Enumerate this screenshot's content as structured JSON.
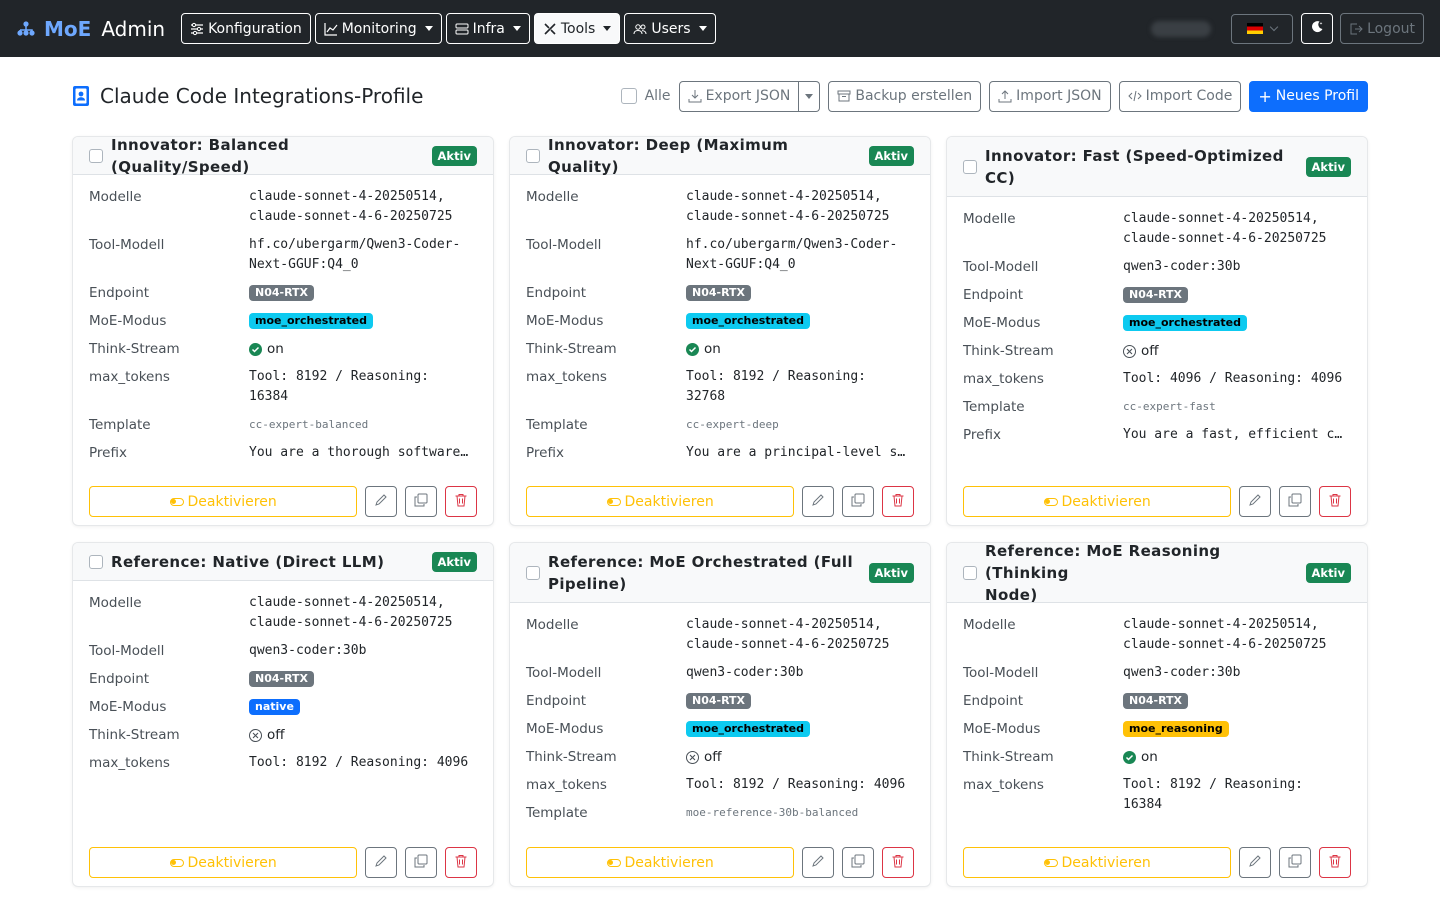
{
  "nav": {
    "brand_moe": "MoE",
    "brand_admin": "Admin",
    "menu": [
      {
        "label": "Konfiguration",
        "icon": "sliders-icon"
      },
      {
        "label": "Monitoring",
        "icon": "chart-line-icon"
      },
      {
        "label": "Infra",
        "icon": "server-icon"
      },
      {
        "label": "Tools",
        "icon": "tools-icon"
      },
      {
        "label": "Users",
        "icon": "users-icon"
      }
    ],
    "logout": "Logout",
    "language_flag": "de-flag-icon"
  },
  "header": {
    "title": "Claude Code Integrations-Profile",
    "select_all": "Alle",
    "export_json": "Export JSON",
    "backup": "Backup erstellen",
    "import_json": "Import JSON",
    "import_code": "Import Code",
    "new_profile": "Neues Profil"
  },
  "labels": {
    "models": "Modelle",
    "tool_model": "Tool-Modell",
    "endpoint": "Endpoint",
    "moe_mode": "MoE-Modus",
    "think_stream": "Think-Stream",
    "max_tokens": "max_tokens",
    "template": "Template",
    "prefix": "Prefix",
    "deactivate": "Deaktivieren",
    "active": "Aktiv"
  },
  "colors": {
    "navbar": "#212529",
    "primary": "#0d6efd",
    "success": "#198754",
    "warning": "#ffc107",
    "danger": "#dc3545",
    "info": "#0dcaf0"
  },
  "profiles": [
    {
      "title": "Innovator: Balanced (Quality/Speed)",
      "models_1": "claude-sonnet-4-20250514,",
      "models_2": "claude-sonnet-4-6-20250725",
      "tool_model_1": "hf.co/ubergarm/Qwen3-Coder-",
      "tool_model_2": "Next-GGUF:Q4_0",
      "endpoint": "N04-RTX",
      "moe_mode": "moe_orchestrated",
      "think_stream": "on",
      "max_tokens_1": "Tool: 8192 / Reasoning:",
      "max_tokens_2": "16384",
      "template": "cc-expert-balanced",
      "prefix": "You are a thorough software…"
    },
    {
      "title": "Innovator: Deep (Maximum Quality)",
      "models_1": "claude-sonnet-4-20250514,",
      "models_2": "claude-sonnet-4-6-20250725",
      "tool_model_1": "hf.co/ubergarm/Qwen3-Coder-",
      "tool_model_2": "Next-GGUF:Q4_0",
      "endpoint": "N04-RTX",
      "moe_mode": "moe_orchestrated",
      "think_stream": "on",
      "max_tokens_1": "Tool: 8192 / Reasoning:",
      "max_tokens_2": "32768",
      "template": "cc-expert-deep",
      "prefix": "You are a principal-level s…"
    },
    {
      "title_1": "Innovator: Fast (Speed-Optimized",
      "title_2": "CC)",
      "models_1": "claude-sonnet-4-20250514,",
      "models_2": "claude-sonnet-4-6-20250725",
      "tool_model": "qwen3-coder:30b",
      "endpoint": "N04-RTX",
      "moe_mode": "moe_orchestrated",
      "think_stream": "off",
      "max_tokens": "Tool: 4096 / Reasoning: 4096",
      "template": "cc-expert-fast",
      "prefix": "You are a fast, efficient c…"
    },
    {
      "title": "Reference: Native (Direct LLM)",
      "models_1": "claude-sonnet-4-20250514,",
      "models_2": "claude-sonnet-4-6-20250725",
      "tool_model": "qwen3-coder:30b",
      "endpoint": "N04-RTX",
      "moe_mode": "native",
      "think_stream": "off",
      "max_tokens": "Tool: 8192 / Reasoning: 4096"
    },
    {
      "title_1": "Reference: MoE Orchestrated (Full",
      "title_2": "Pipeline)",
      "models_1": "claude-sonnet-4-20250514,",
      "models_2": "claude-sonnet-4-6-20250725",
      "tool_model": "qwen3-coder:30b",
      "endpoint": "N04-RTX",
      "moe_mode": "moe_orchestrated",
      "think_stream": "off",
      "max_tokens": "Tool: 8192 / Reasoning: 4096",
      "template": "moe-reference-30b-balanced"
    },
    {
      "title_1": "Reference: MoE Reasoning (Thinking",
      "title_2": "Node)",
      "models_1": "claude-sonnet-4-20250514,",
      "models_2": "claude-sonnet-4-6-20250725",
      "tool_model": "qwen3-coder:30b",
      "endpoint": "N04-RTX",
      "moe_mode": "moe_reasoning",
      "think_stream": "on",
      "max_tokens_1": "Tool: 8192 / Reasoning:",
      "max_tokens_2": "16384"
    }
  ]
}
